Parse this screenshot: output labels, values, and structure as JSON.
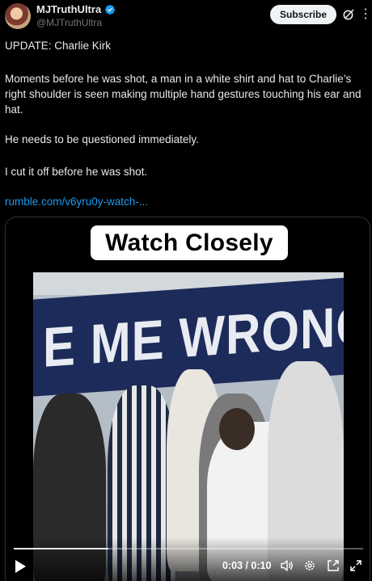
{
  "author": {
    "display_name": "MJTruthUltra",
    "handle": "@MJTruthUltra",
    "verified_icon": "verified-badge-icon"
  },
  "header": {
    "subscribe_label": "Subscribe",
    "grok_icon": "grok-icon",
    "more_icon": "more-icon"
  },
  "tweet": {
    "line1": "UPDATE: Charlie Kirk",
    "line2": "Moments before he was shot, a man in a white shirt and hat to Charlie’s right shoulder is seen making multiple hand gestures touching his ear and hat.",
    "line3": "He needs to be questioned immediately.",
    "line4": "I cut it off before he was shot.",
    "link": "rumble.com/v6yru0y-watch-..."
  },
  "media": {
    "caption": "Watch Closely",
    "banner_text": "E ME WRONG",
    "current_time": "0:03",
    "duration": "0:10",
    "time_display": "0:03 / 0:10",
    "progress_fraction": 0.27
  },
  "colors": {
    "background": "#000000",
    "link": "#1d9bf0",
    "subscribe_bg": "#eff3f4",
    "verified": "#1d9bf0",
    "banner": "#1d2b5a"
  }
}
